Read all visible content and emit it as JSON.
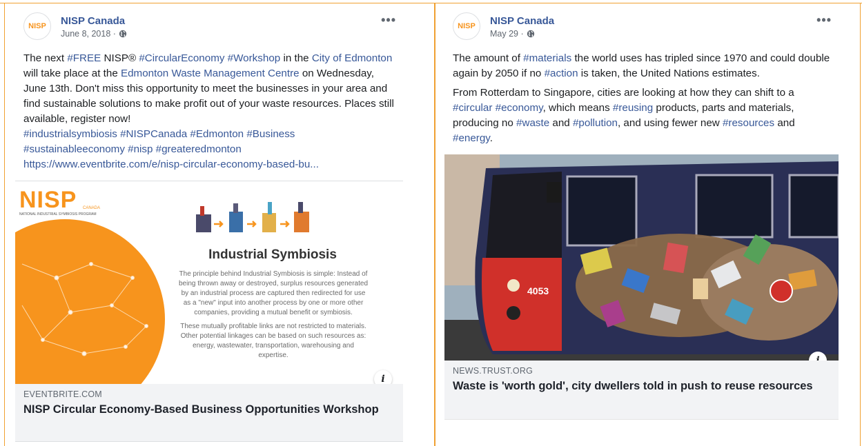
{
  "colors": {
    "divider": "#f0a030",
    "link": "#385898",
    "nisp_orange": "#f7941d"
  },
  "posts": [
    {
      "page_name": "NISP Canada",
      "date": "June 8, 2018 ·",
      "avatar_logo": "NISP",
      "text": {
        "p1_a": "The next ",
        "p1_free": "#FREE",
        "p1_b": " NISP® ",
        "p1_ce": "#CircularEconomy",
        "p1_c": " ",
        "p1_ws": "#Workshop",
        "p1_d": " in the ",
        "p1_city": "City of Edmonton",
        "p1_e": " will take place at the ",
        "p1_ewmc": "Edmonton Waste Management Centre",
        "p1_f": " on Wednesday, June 13th. Don't miss this opportunity to meet the businesses in your area and find sustainable solutions to make profit out of your waste resources. Places still available, register now!",
        "hashtags_line1": "#industrialsymbiosis #NISPCanada #Edmonton #Business",
        "hashtags_line2": "#sustainableeconomy #nisp #greateredmonton",
        "url": "https://www.eventbrite.com/e/nisp-circular-economy-based-bu..."
      },
      "image": {
        "logo_text": "NISP",
        "logo_sub": "CANADA",
        "logo_caption": "NATIONAL INDUSTRIAL SYMBIOSIS PROGRAM",
        "title": "Industrial Symbiosis",
        "body_p1": "The principle behind Industrial Symbiosis is simple: Instead of being thrown away or destroyed, surplus resources generated by an industrial process are captured then redirected for use as a \"new\" input into another process by one or more other companies, providing a mutual benefit or symbiosis.",
        "body_p2": "These mutually profitable links are not restricted to materials. Other potential linkages can be based on such resources as: energy, wastewater, transportation, warehousing and expertise."
      },
      "preview": {
        "domain": "EVENTBRITE.COM",
        "headline": "NISP Circular Economy-Based Business Opportunities Workshop"
      }
    },
    {
      "page_name": "NISP Canada",
      "date": "May 29 ·",
      "avatar_logo": "NISP",
      "text": {
        "p1_a": "The amount of ",
        "p1_materials": "#materials",
        "p1_b": " the world uses has tripled since 1970 and could double again by 2050 if no ",
        "p1_action": "#action",
        "p1_c": " is taken, the United Nations estimates.",
        "p2_a": "From Rotterdam to Singapore, cities are looking at how they can shift to a ",
        "p2_circular": "#circular",
        "p2_sp1": " ",
        "p2_economy": "#economy",
        "p2_b": ", which means ",
        "p2_reusing": "#reusing",
        "p2_c": " products, parts and materials, producing no ",
        "p2_waste": "#waste",
        "p2_d": " and ",
        "p2_pollution": "#pollution",
        "p2_e": ", and using fewer new ",
        "p2_resources": "#resources",
        "p2_f": " and ",
        "p2_energy": "#energy",
        "p2_g": "."
      },
      "image": {
        "tram_number": "4053"
      },
      "preview": {
        "domain": "NEWS.TRUST.ORG",
        "headline": "Waste is 'worth gold', city dwellers told in push to reuse resources"
      }
    }
  ],
  "icons": {
    "more": "•••",
    "info": "i",
    "globe": "globe-icon"
  }
}
